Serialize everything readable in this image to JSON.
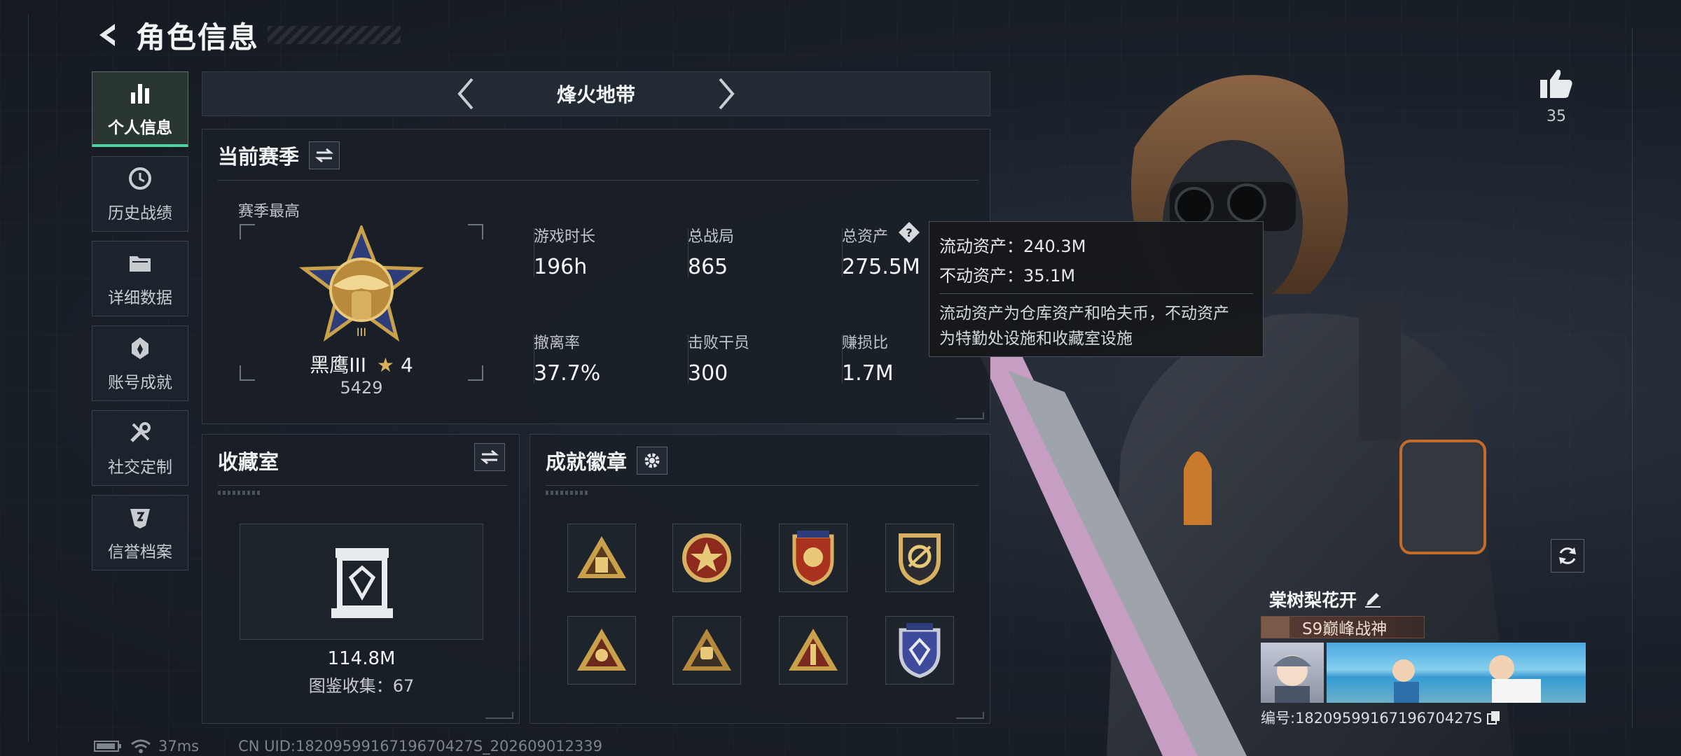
{
  "header": {
    "title": "角色信息"
  },
  "sidebar": {
    "items": [
      {
        "label": "个人信息",
        "icon": "bar-chart-icon",
        "active": true
      },
      {
        "label": "历史战绩",
        "icon": "history-icon"
      },
      {
        "label": "详细数据",
        "icon": "folder-icon"
      },
      {
        "label": "账号成就",
        "icon": "achievement-icon"
      },
      {
        "label": "社交定制",
        "icon": "tools-icon"
      },
      {
        "label": "信誉档案",
        "icon": "credit-icon"
      }
    ]
  },
  "mode": {
    "title": "烽火地带"
  },
  "season": {
    "title": "当前赛季",
    "best_label": "赛季最高",
    "rank_name": "黑鹰III",
    "rank_stars": "4",
    "rank_score": "5429",
    "stats": [
      {
        "key": "游戏时长",
        "value": "196h"
      },
      {
        "key": "总战局",
        "value": "865"
      },
      {
        "key": "总资产",
        "value": "275.5M"
      },
      {
        "key": "撤离率",
        "value": "37.7%"
      },
      {
        "key": "击败干员",
        "value": "300"
      },
      {
        "key": "赚损比",
        "value": "1.7M"
      }
    ]
  },
  "tooltip": {
    "liquid": "流动资产：240.3M",
    "fixed": "不动资产：35.1M",
    "note_line1": "流动资产为仓库资产和哈夫币，不动资产",
    "note_line2": "为特勤处设施和收藏室设施"
  },
  "collection": {
    "title": "收藏室",
    "value": "114.8M",
    "count": "图鉴收集：67"
  },
  "badges": {
    "title": "成就徽章",
    "items": [
      "triangle-soldiers-badge",
      "star-shield-badge",
      "eagle-crest-badge",
      "gold-wreath-badge",
      "skull-triangle-badge",
      "fist-triangle-badge",
      "tower-triangle-badge",
      "blue-shield-badge"
    ]
  },
  "likes": {
    "count": "35"
  },
  "character": {
    "name": "棠树梨花开",
    "title": "S9巅峰战神",
    "id": "编号:1820959916719670427S"
  },
  "status": {
    "ping": "37ms",
    "uid": "CN UID:1820959916719670427S_202609012339"
  },
  "colors": {
    "accent": "#4fd1a0",
    "panel": "#1a1f27",
    "gold": "#c9a14a"
  }
}
